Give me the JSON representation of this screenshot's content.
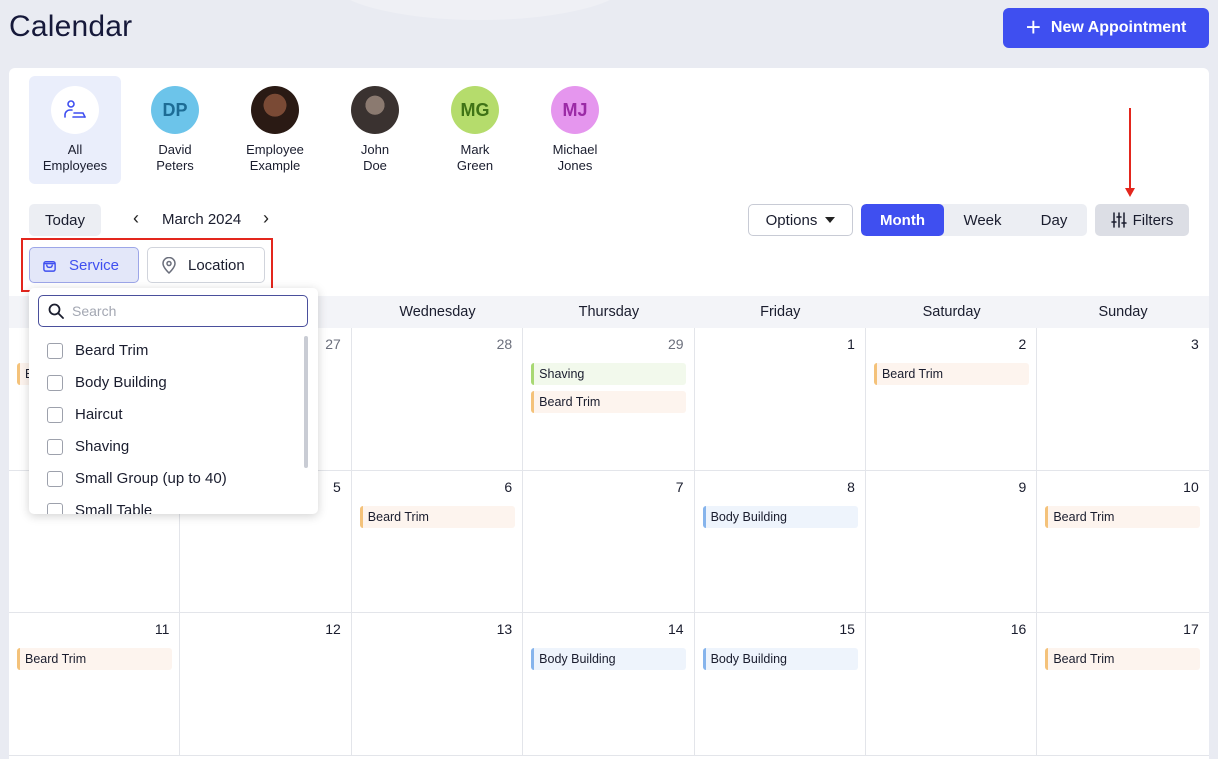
{
  "header": {
    "title": "Calendar",
    "new_appointment_label": "New Appointment"
  },
  "employees": [
    {
      "name": "All\nEmployees",
      "active": true,
      "icon": "employees-group-icon"
    },
    {
      "name": "David\nPeters",
      "initials": "DP",
      "color": "#6cc4ea",
      "text_color": "#1d6c95"
    },
    {
      "name": "Employee\nExample",
      "photo": "photo-avatar"
    },
    {
      "name": "John\nDoe",
      "photo": "photo-avatar"
    },
    {
      "name": "Mark\nGreen",
      "initials": "MG",
      "color": "#b5dc6c",
      "text_color": "#3f7316"
    },
    {
      "name": "Michael\nJones",
      "initials": "MJ",
      "color": "#e596ee",
      "text_color": "#9b2aa6"
    }
  ],
  "toolbar": {
    "today": "Today",
    "month_label": "March 2024",
    "options": "Options",
    "views": [
      "Month",
      "Week",
      "Day"
    ],
    "active_view": "Month",
    "filters": "Filters"
  },
  "filter_chips": {
    "service": "Service",
    "location": "Location"
  },
  "dropdown": {
    "search_placeholder": "Search",
    "options": [
      "Beard Trim",
      "Body Building",
      "Haircut",
      "Shaving",
      "Small Group (up to 40)",
      "Small Table"
    ]
  },
  "weekdays_visible": [
    "Wednesday",
    "Thursday",
    "Friday",
    "Saturday",
    "Sunday"
  ],
  "calendar_rows": [
    {
      "days": [
        {
          "num": "",
          "events": [
            {
              "label": "B",
              "type": "beard"
            }
          ]
        },
        {
          "num": "27",
          "muted": true,
          "events": []
        },
        {
          "num": "28",
          "muted": true,
          "events": []
        },
        {
          "num": "29",
          "muted": true,
          "events": [
            {
              "label": "Shaving",
              "type": "shave"
            },
            {
              "label": "Beard Trim",
              "type": "beard"
            }
          ]
        },
        {
          "num": "1",
          "events": []
        },
        {
          "num": "2",
          "events": [
            {
              "label": "Beard Trim",
              "type": "beard"
            }
          ]
        },
        {
          "num": "3",
          "events": []
        }
      ]
    },
    {
      "days": [
        {
          "num": "",
          "events": []
        },
        {
          "num": "5",
          "events": []
        },
        {
          "num": "6",
          "events": [
            {
              "label": "Beard Trim",
              "type": "beard"
            }
          ]
        },
        {
          "num": "7",
          "events": []
        },
        {
          "num": "8",
          "events": [
            {
              "label": "Body Building",
              "type": "body"
            }
          ]
        },
        {
          "num": "9",
          "events": []
        },
        {
          "num": "10",
          "events": [
            {
              "label": "Beard Trim",
              "type": "beard"
            }
          ]
        }
      ]
    },
    {
      "days": [
        {
          "num": "11",
          "events": [
            {
              "label": "Beard Trim",
              "type": "beard"
            }
          ]
        },
        {
          "num": "12",
          "events": []
        },
        {
          "num": "13",
          "events": []
        },
        {
          "num": "14",
          "events": [
            {
              "label": "Body Building",
              "type": "body"
            }
          ]
        },
        {
          "num": "15",
          "events": [
            {
              "label": "Body Building",
              "type": "body"
            }
          ]
        },
        {
          "num": "16",
          "events": []
        },
        {
          "num": "17",
          "events": [
            {
              "label": "Beard Trim",
              "type": "beard"
            }
          ]
        }
      ]
    }
  ],
  "colors": {
    "accent": "#3f4ff0",
    "highlight": "#e3261d"
  }
}
